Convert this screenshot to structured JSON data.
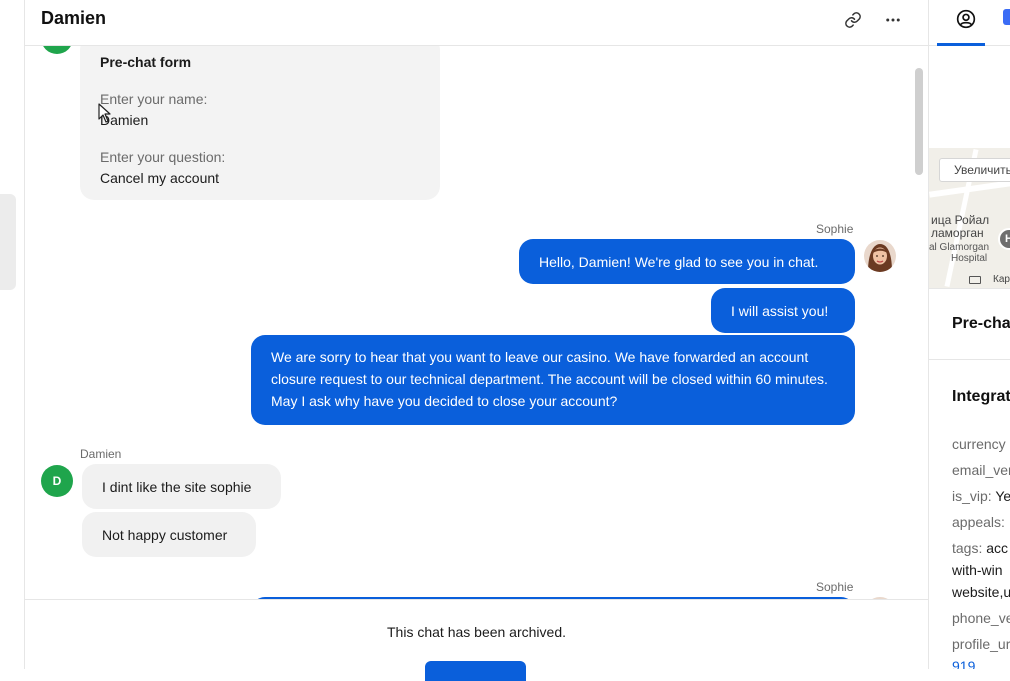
{
  "chat": {
    "title": "Damien",
    "prechat": {
      "title": "Pre-chat form",
      "name_label": "Enter your name:",
      "name_value": "Damien",
      "question_label": "Enter your question:",
      "question_value": "Cancel my account"
    },
    "messages": [
      {
        "author": "Sophie",
        "text": "Hello, Damien! We're glad to see you in chat."
      },
      {
        "text": "I will assist you!"
      },
      {
        "text": "We are sorry to hear that you want to leave our casino. We have forwarded an account closure request to our technical department. The account will be closed within 60 minutes. May I ask why have you decided to close your account?"
      },
      {
        "author": "Damien",
        "avatar_initial": "D",
        "text": "I dint like the site sophie"
      },
      {
        "text": "Not happy customer"
      },
      {
        "author": "Sophie"
      }
    ],
    "archived_note": "This chat has been archived."
  },
  "right_panel": {
    "map": {
      "zoom_label": "Увеличить",
      "place_line1": "ица Ройал",
      "place_line2": "ламорган",
      "hospital_line1": "al Glamorgan",
      "hospital_line2": "Hospital",
      "pin_letter": "H",
      "attribution": "Кар"
    },
    "prechat_title": "Pre-cha",
    "integrations_title": "Integrat",
    "fields": [
      {
        "key": "currency"
      },
      {
        "key": "email_ver"
      },
      {
        "key": "is_vip: ",
        "value": "Ye"
      },
      {
        "key": "appeals:"
      },
      {
        "key": "tags: ",
        "value": "acc",
        "line2": "with-win",
        "line3": "website,u"
      },
      {
        "key": "phone_ve"
      },
      {
        "key": "profile_ur",
        "link": "919"
      }
    ]
  },
  "colors": {
    "agent_bubble": "#0a5fdb",
    "customer_bubble": "#f1f1f1",
    "customer_avatar": "#1fa54c"
  },
  "icons": [
    "link-icon",
    "more-icon",
    "user-circle-icon",
    "keyboard-icon",
    "map-pin-icon"
  ]
}
